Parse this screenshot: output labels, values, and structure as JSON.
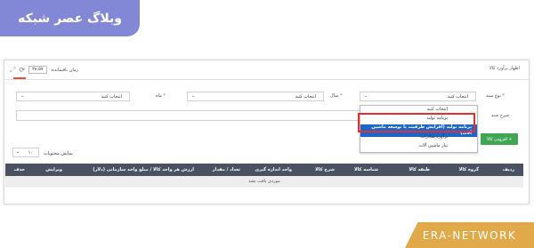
{
  "badge": "وبلاگ عصر شبکه",
  "brand": "ERA-NETWORK",
  "header": {
    "title": "اظهار برآورد کالا",
    "time_label": "زمان باقیمانده:",
    "time_value": "۲۸:۵۷"
  },
  "form": {
    "type_label": "نوع سند",
    "type_value": "انتخاب کنید",
    "year_label": "سال",
    "year_value": "انتخاب کنید",
    "month_label": "ماه",
    "month_value": "انتخاب کنید",
    "desc_label": "شرح سند",
    "required_mark": "*",
    "chevron": "⌄"
  },
  "dropdown": {
    "options": [
      "انتخاب کنید",
      "برنامه تولید",
      "برنامه تولید (افزایش ظرفیت یا توسعه ماشین آلات)",
      "برآورد صادرات",
      "نیاز ماشین آلات"
    ],
    "selected_index": 2
  },
  "add_button": {
    "label": "افزودن کالا",
    "icon": "+"
  },
  "paging": {
    "label": "نمایش محتویات",
    "value": "۱۰"
  },
  "table": {
    "headers": [
      "ردیف",
      "گروه کالا",
      "طبقه کالا",
      "شناسه کالا",
      "شرح کالا",
      "واحد اندازه گیری",
      "تعداد / مقدار",
      "ارزش هر واحد کالا / مبلغ واحد سازمانی (دلار)",
      "ویرایش",
      "حذف"
    ],
    "empty_text": "موردی یافت نشد"
  },
  "icons": {
    "expand": "⤢",
    "refresh": "⟳"
  }
}
